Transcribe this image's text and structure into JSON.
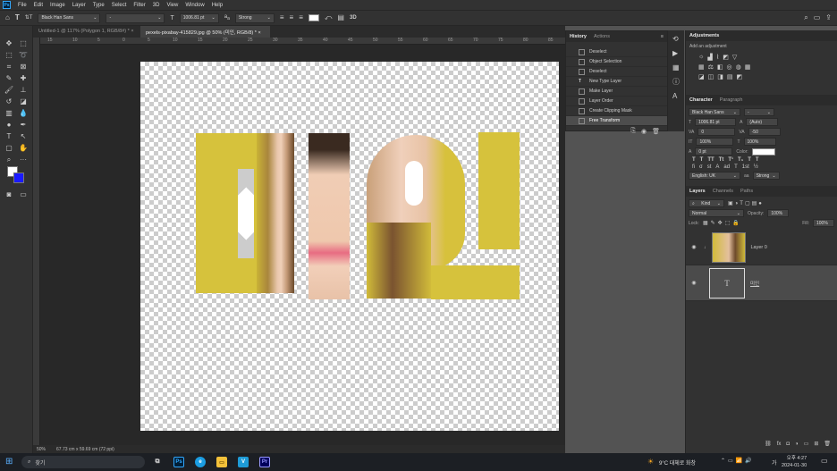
{
  "menubar": {
    "items": [
      "File",
      "Edit",
      "Image",
      "Layer",
      "Type",
      "Select",
      "Filter",
      "3D",
      "View",
      "Window",
      "Help"
    ],
    "logo": "Ps"
  },
  "options": {
    "font_family": "Black Han Sans",
    "font_style": "-",
    "font_size": "1006.81 pt",
    "antialias": "Strong",
    "threed": "3D"
  },
  "tabs": [
    {
      "label": "Untitled-1 @ 117% (Polygon 1, RGB/8#) *"
    },
    {
      "label": "pexels-pixabay-415829.jpg @ 50% (미인, RGB/8) *"
    }
  ],
  "ruler": [
    "15",
    "10",
    "5",
    "0",
    "5",
    "10",
    "15",
    "20",
    "25",
    "30",
    "35",
    "40",
    "45",
    "50",
    "55",
    "60",
    "65",
    "70",
    "75",
    "80",
    "85"
  ],
  "status": {
    "zoom": "50%",
    "size": "67.73 cm x 59.69 cm (72 ppi)"
  },
  "history": {
    "tabs": [
      "History",
      "Actions"
    ],
    "items": [
      "Deselect",
      "Object Selection",
      "Deselect",
      "New Type Layer",
      "Make Layer",
      "Layer Order",
      "Create Clipping Mask",
      "Free Transform"
    ]
  },
  "adjustments": {
    "tab": "Adjustments",
    "subtitle": "Add an adjustment"
  },
  "character": {
    "tabs": [
      "Character",
      "Paragraph"
    ],
    "font_family": "Black Han Sans",
    "font_style": "-",
    "size": "1006.81 pt",
    "leading": "(Auto)",
    "kerning": "0",
    "tracking": "-50",
    "vscale": "100%",
    "hscale": "100%",
    "baseline": "0 pt",
    "color_label": "Color:",
    "language": "English: UK",
    "antialias": "Strong"
  },
  "layers": {
    "tabs": [
      "Layers",
      "Channels",
      "Paths"
    ],
    "filter": "Kind",
    "blend": "Normal",
    "opacity_label": "Opacity:",
    "opacity": "100%",
    "lock_label": "Lock:",
    "fill_label": "Fill:",
    "fill": "100%",
    "items": [
      {
        "name": "Layer 0"
      },
      {
        "name": "미인"
      }
    ]
  },
  "taskbar": {
    "search": "찾기",
    "weather": "9°C 대체로 화창",
    "ime": "가",
    "time": "오후 4:27",
    "date": "2024-01-30"
  }
}
